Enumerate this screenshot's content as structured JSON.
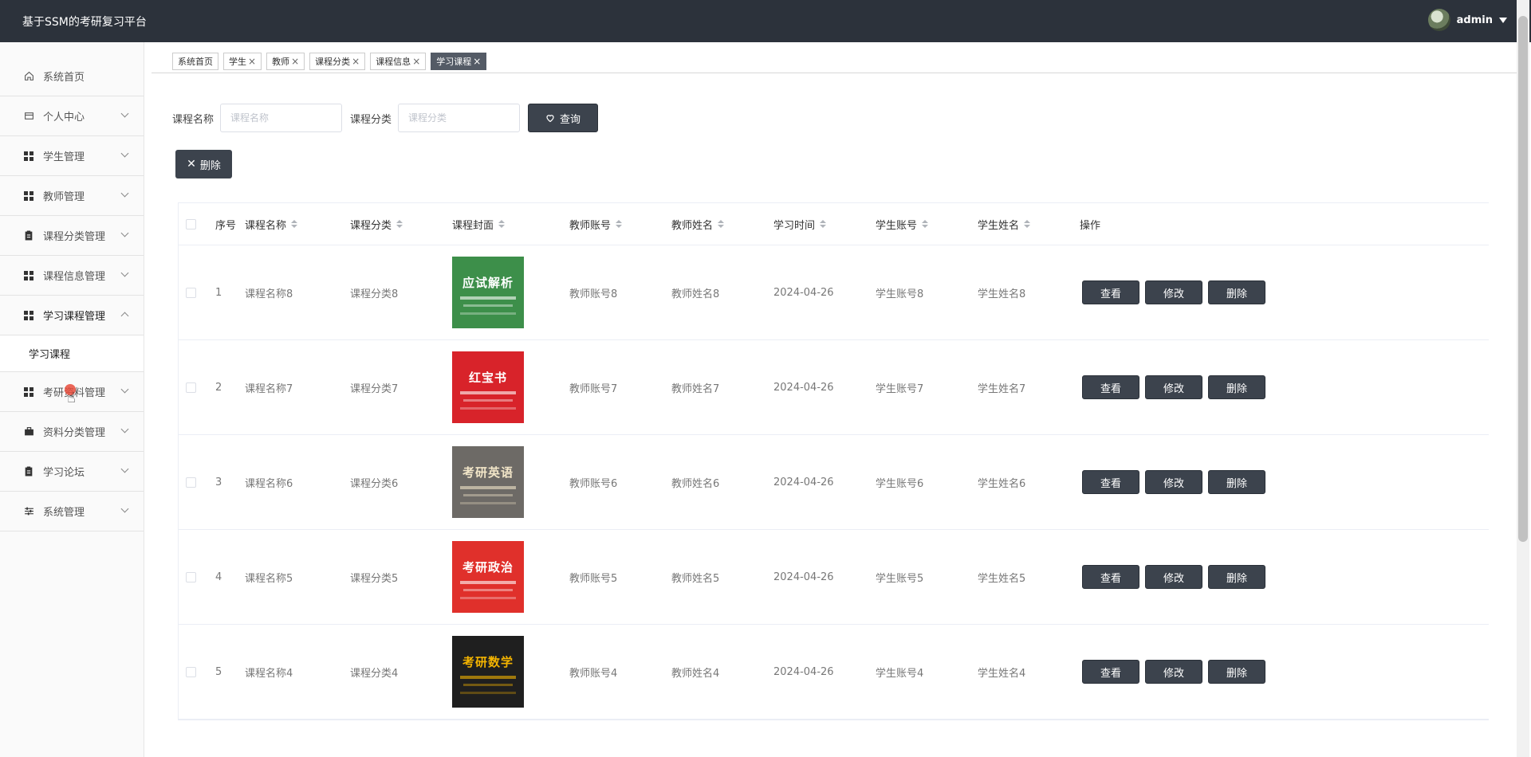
{
  "app": {
    "title": "基于SSM的考研复习平台",
    "user": "admin"
  },
  "sidebar": {
    "items": [
      {
        "label": "系统首页",
        "icon": "home-icon",
        "chevron": false
      },
      {
        "label": "个人中心",
        "icon": "card-icon",
        "chevron": true
      },
      {
        "label": "学生管理",
        "icon": "grid-icon",
        "chevron": true
      },
      {
        "label": "教师管理",
        "icon": "grid-icon",
        "chevron": true
      },
      {
        "label": "课程分类管理",
        "icon": "clipboard-icon",
        "chevron": true
      },
      {
        "label": "课程信息管理",
        "icon": "grid-icon",
        "chevron": true
      },
      {
        "label": "学习课程管理",
        "icon": "grid-icon",
        "chevron": true,
        "expanded": true
      },
      {
        "label": "考研资料管理",
        "icon": "grid-icon",
        "chevron": true
      },
      {
        "label": "资料分类管理",
        "icon": "briefcase-icon",
        "chevron": true
      },
      {
        "label": "学习论坛",
        "icon": "clipboard-icon",
        "chevron": true
      },
      {
        "label": "系统管理",
        "icon": "sliders-icon",
        "chevron": true
      }
    ],
    "submenu": {
      "label": "学习课程"
    }
  },
  "tabs": [
    {
      "label": "系统首页",
      "closable": false,
      "active": false
    },
    {
      "label": "学生",
      "closable": true,
      "active": false
    },
    {
      "label": "教师",
      "closable": true,
      "active": false
    },
    {
      "label": "课程分类",
      "closable": true,
      "active": false
    },
    {
      "label": "课程信息",
      "closable": true,
      "active": false
    },
    {
      "label": "学习课程",
      "closable": true,
      "active": true
    }
  ],
  "search": {
    "name_label": "课程名称",
    "name_placeholder": "课程名称",
    "category_label": "课程分类",
    "category_placeholder": "课程分类",
    "query_label": "查询"
  },
  "batch_delete_label": "删除",
  "table": {
    "headers": [
      "序号",
      "课程名称",
      "课程分类",
      "课程封面",
      "教师账号",
      "教师姓名",
      "学习时间",
      "学生账号",
      "学生姓名",
      "操作"
    ],
    "actions": {
      "view": "查看",
      "edit": "修改",
      "delete": "删除"
    },
    "rows": [
      {
        "index": "1",
        "name": "课程名称8",
        "category": "课程分类8",
        "teacher_account": "教师账号8",
        "teacher_name": "教师姓名8",
        "time": "2024-04-26",
        "student_account": "学生账号8",
        "student_name": "学生姓名8",
        "cover_text": "应试解析",
        "cover_bg": "#3d8f4a",
        "cover_fg": "#ffffff"
      },
      {
        "index": "2",
        "name": "课程名称7",
        "category": "课程分类7",
        "teacher_account": "教师账号7",
        "teacher_name": "教师姓名7",
        "time": "2024-04-26",
        "student_account": "学生账号7",
        "student_name": "学生姓名7",
        "cover_text": "红宝书",
        "cover_bg": "#d8232a",
        "cover_fg": "#ffffff"
      },
      {
        "index": "3",
        "name": "课程名称6",
        "category": "课程分类6",
        "teacher_account": "教师账号6",
        "teacher_name": "教师姓名6",
        "time": "2024-04-26",
        "student_account": "学生账号6",
        "student_name": "学生姓名6",
        "cover_text": "考研英语",
        "cover_bg": "#6d6a66",
        "cover_fg": "#f2e6c8"
      },
      {
        "index": "4",
        "name": "课程名称5",
        "category": "课程分类5",
        "teacher_account": "教师账号5",
        "teacher_name": "教师姓名5",
        "time": "2024-04-26",
        "student_account": "学生账号5",
        "student_name": "学生姓名5",
        "cover_text": "考研政治",
        "cover_bg": "#e0302b",
        "cover_fg": "#ffffff"
      },
      {
        "index": "5",
        "name": "课程名称4",
        "category": "课程分类4",
        "teacher_account": "教师账号4",
        "teacher_name": "教师姓名4",
        "time": "2024-04-26",
        "student_account": "学生账号4",
        "student_name": "学生姓名4",
        "cover_text": "考研数学",
        "cover_bg": "#1f1f1f",
        "cover_fg": "#f4b400"
      }
    ]
  },
  "colors": {
    "topbar": "#2c323b",
    "button": "#3c434d",
    "active_tab": "#545b66"
  }
}
